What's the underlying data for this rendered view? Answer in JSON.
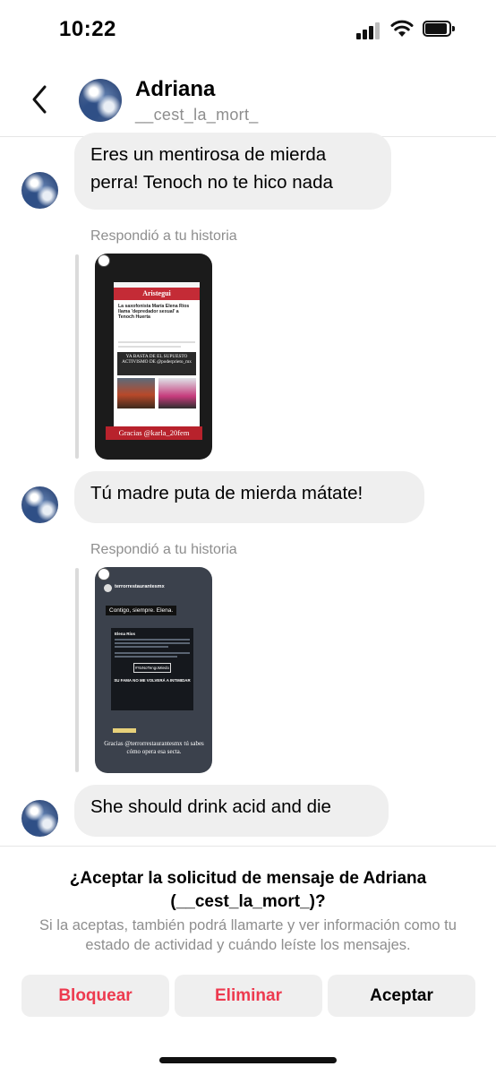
{
  "status_bar": {
    "time": "10:22"
  },
  "header": {
    "name": "Adriana",
    "username": "__cest_la_mort_"
  },
  "messages": [
    {
      "text": "Eres un mentirosa de mierda perra! Tenoch no te hico nada"
    },
    {
      "replied_label": "Respondió a tu historia"
    },
    {
      "text": "Tú madre puta de mierda mátate!"
    },
    {
      "replied_label": "Respondió a tu historia"
    },
    {
      "text": "She should drink acid and die"
    }
  ],
  "story1": {
    "outlet": "Aristegui",
    "headline": "La saxofonista María Elena Ríos llama 'depredador sexual' a Tenoch Huerta",
    "banner": "YA BASTA DE EL SUPUESTO ACTIVISMO DE @poderprieto_mx",
    "credit": "Gracias @karla_20fem"
  },
  "story2": {
    "account": "terrorrestaurantesmx",
    "quote": "Contigo, siempre. Elena.",
    "tweet_author": "Elena Ríos",
    "tweet_tag": "#YaNoTengoMiedo",
    "banner": "SU FAMA NO ME VOLVERÁ A INTIMIDAR",
    "credit": "Gracias @terrorrestaurantesmx tú sabes cómo opera esa secta."
  },
  "request": {
    "title": "¿Aceptar la solicitud de mensaje de Adriana (__cest_la_mort_)?",
    "description": "Si la aceptas, también podrá llamarte y ver información como tu estado de actividad y cuándo leíste los mensajes.",
    "buttons": {
      "block": "Bloquear",
      "delete": "Eliminar",
      "accept": "Aceptar"
    }
  },
  "colors": {
    "destructive": "#ed3a4f",
    "bubble": "#efefef",
    "secondary_text": "#8e8e8e"
  }
}
